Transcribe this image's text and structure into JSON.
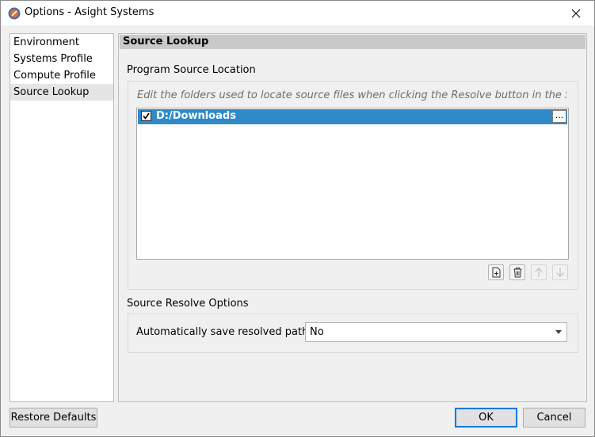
{
  "window": {
    "title": "Options - Asight Systems"
  },
  "nav": {
    "items": [
      {
        "label": "Environment"
      },
      {
        "label": "Systems Profile"
      },
      {
        "label": "Compute Profile"
      },
      {
        "label": "Source Lookup"
      }
    ],
    "selected": "Source Lookup"
  },
  "panel": {
    "header": "Source Lookup",
    "program_source": {
      "title": "Program Source Location",
      "hint": "Edit the folders used to locate source files when clicking the Resolve button in the Sou...",
      "folders": [
        {
          "path": "D:/Downloads",
          "checked": true
        }
      ],
      "browse_label": "..."
    },
    "resolve_options": {
      "title": "Source Resolve Options",
      "auto_save_label": "Automatically save resolved paths",
      "auto_save_value": "No"
    }
  },
  "buttons": {
    "restore": "Restore Defaults",
    "ok": "OK",
    "cancel": "Cancel"
  },
  "colors": {
    "selection": "#2f8ac8",
    "header_bg": "#c9c9c9",
    "accent": "#0078d7"
  },
  "icons": [
    "app-icon",
    "close-icon",
    "add-folder-icon",
    "delete-icon",
    "move-up-icon",
    "move-down-icon",
    "checkmark-icon",
    "dropdown-arrow-icon"
  ]
}
